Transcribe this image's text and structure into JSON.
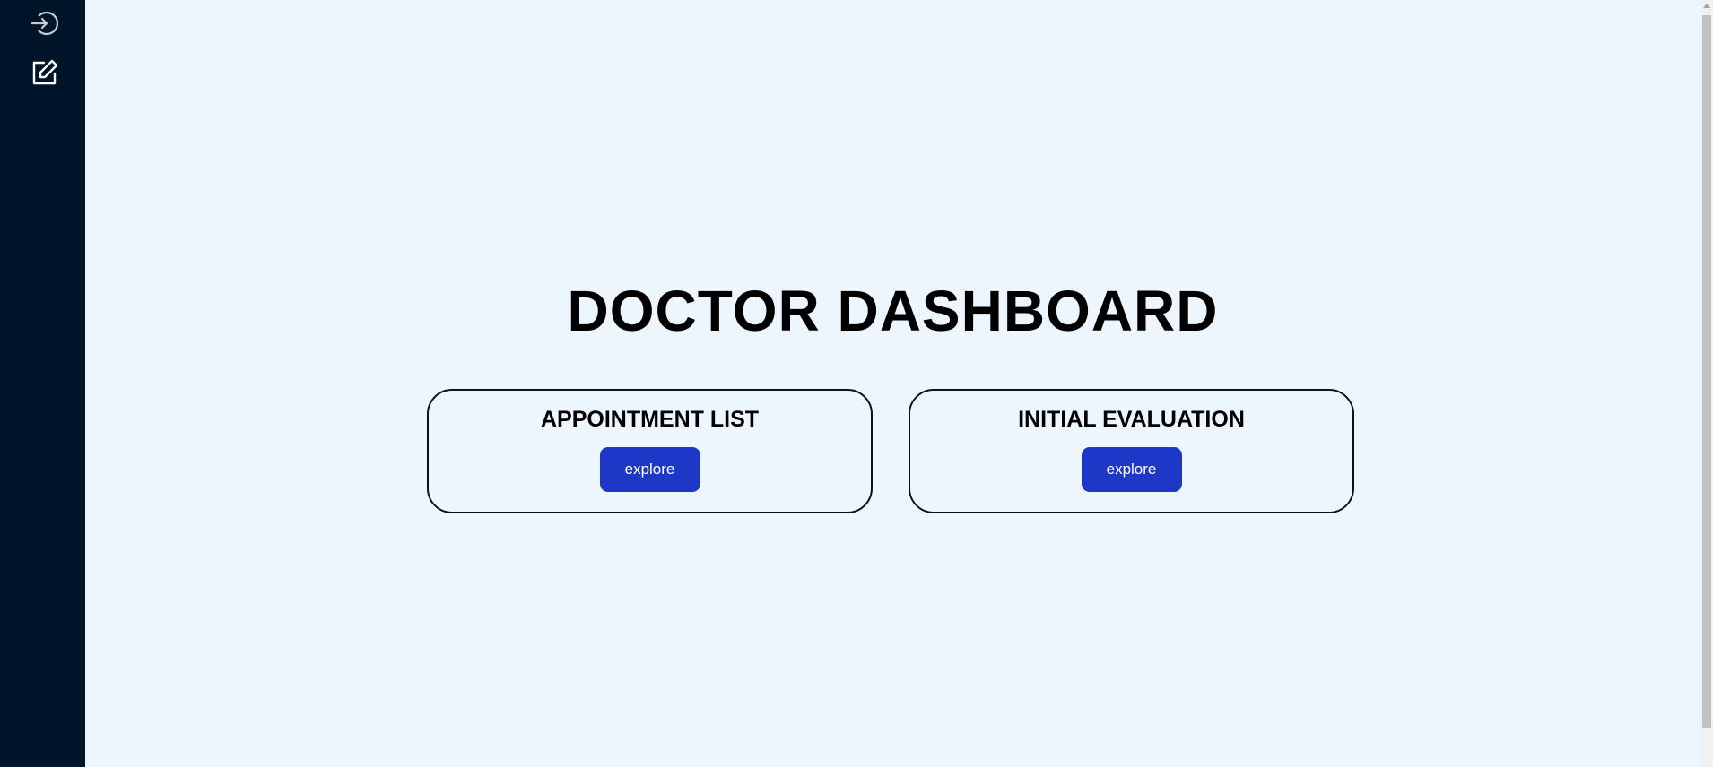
{
  "sidebar": {
    "icons": [
      {
        "name": "login-icon"
      },
      {
        "name": "edit-icon"
      }
    ]
  },
  "main": {
    "title": "DOCTOR DASHBOARD",
    "cards": [
      {
        "title": "APPOINTMENT LIST",
        "button_label": "explore"
      },
      {
        "title": "INITIAL EVALUATION",
        "button_label": "explore"
      }
    ]
  },
  "colors": {
    "sidebar_bg": "#00142a",
    "page_bg": "#eef6fd",
    "button_bg": "#1d38c7"
  }
}
